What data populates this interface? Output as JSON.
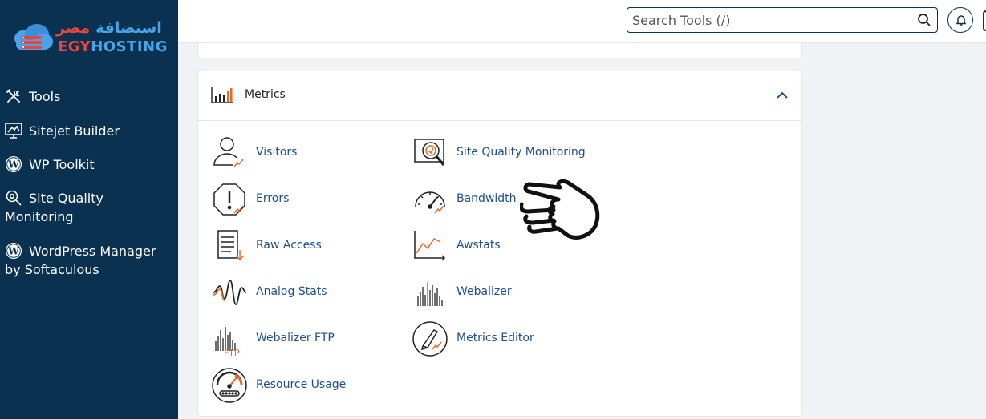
{
  "brand": {
    "arabic_part1": "استضافة",
    "arabic_part2": "مصر",
    "english_part1": "EGY",
    "english_part2": "HOSTING"
  },
  "sidebar": {
    "items": [
      {
        "label": "Tools",
        "icon": "tools-icon"
      },
      {
        "label": "Sitejet Builder",
        "icon": "monitor-icon"
      },
      {
        "label": "WP Toolkit",
        "icon": "wordpress-icon"
      },
      {
        "label": "Site Quality Monitoring",
        "icon": "search-gear-icon"
      },
      {
        "label": "WordPress Manager by Softaculous",
        "icon": "wordpress-icon"
      }
    ]
  },
  "header": {
    "search_placeholder": "Search Tools (/)",
    "search_icon": "search-icon",
    "bell_icon": "bell-icon"
  },
  "metrics": {
    "title": "Metrics",
    "tools": [
      {
        "label": "Visitors",
        "icon": "visitors-icon"
      },
      {
        "label": "Site Quality Monitoring",
        "icon": "site-quality-icon"
      },
      {
        "label": "Errors",
        "icon": "errors-icon"
      },
      {
        "label": "Bandwidth",
        "icon": "bandwidth-icon"
      },
      {
        "label": "Raw Access",
        "icon": "raw-access-icon"
      },
      {
        "label": "Awstats",
        "icon": "awstats-icon"
      },
      {
        "label": "Analog Stats",
        "icon": "analog-stats-icon"
      },
      {
        "label": "Webalizer",
        "icon": "webalizer-icon"
      },
      {
        "label": "Webalizer FTP",
        "icon": "webalizer-ftp-icon"
      },
      {
        "label": "Metrics Editor",
        "icon": "metrics-editor-icon"
      },
      {
        "label": "Resource Usage",
        "icon": "resource-usage-icon"
      }
    ],
    "ftp_icon_text": "FTP"
  },
  "colors": {
    "sidebar_bg": "#0a3250",
    "link": "#1f4f8a",
    "accent_orange": "#e8692c"
  }
}
